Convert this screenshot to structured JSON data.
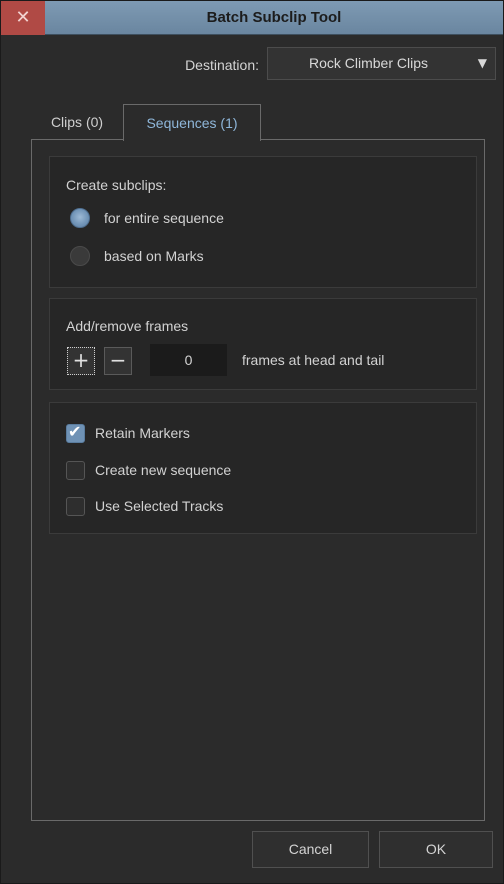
{
  "window": {
    "title": "Batch Subclip Tool",
    "close_glyph": "✕"
  },
  "destination": {
    "label": "Destination:",
    "value": "Rock Climber Clips",
    "arrow_glyph": "▼"
  },
  "tabs": [
    {
      "label": "Clips (0)",
      "selected": false
    },
    {
      "label": "Sequences (1)",
      "selected": true
    }
  ],
  "subclips": {
    "heading": "Create subclips:",
    "options": [
      {
        "label": "for entire sequence",
        "selected": true
      },
      {
        "label": "based on Marks",
        "selected": false
      }
    ]
  },
  "frames": {
    "heading": "Add/remove frames",
    "plus_glyph": "+",
    "minus_glyph": "−",
    "value": "0",
    "suffix": "frames at head and tail"
  },
  "options": {
    "check_glyph": "✔",
    "items": [
      {
        "label": "Retain Markers",
        "checked": true
      },
      {
        "label": "Create new sequence",
        "checked": false
      },
      {
        "label": "Use Selected Tracks",
        "checked": false
      }
    ]
  },
  "buttons": {
    "cancel": "Cancel",
    "ok": "OK"
  },
  "colors": {
    "titlebar": "#7e9ab3",
    "close_button": "#b04a45",
    "accent": "#6f92b5",
    "selected_tab_text": "#8fb7da"
  },
  "icons": {
    "close": "close-icon",
    "dropdown": "chevron-down-icon",
    "plus": "plus-icon",
    "minus": "minus-icon",
    "check": "checkmark-icon"
  }
}
